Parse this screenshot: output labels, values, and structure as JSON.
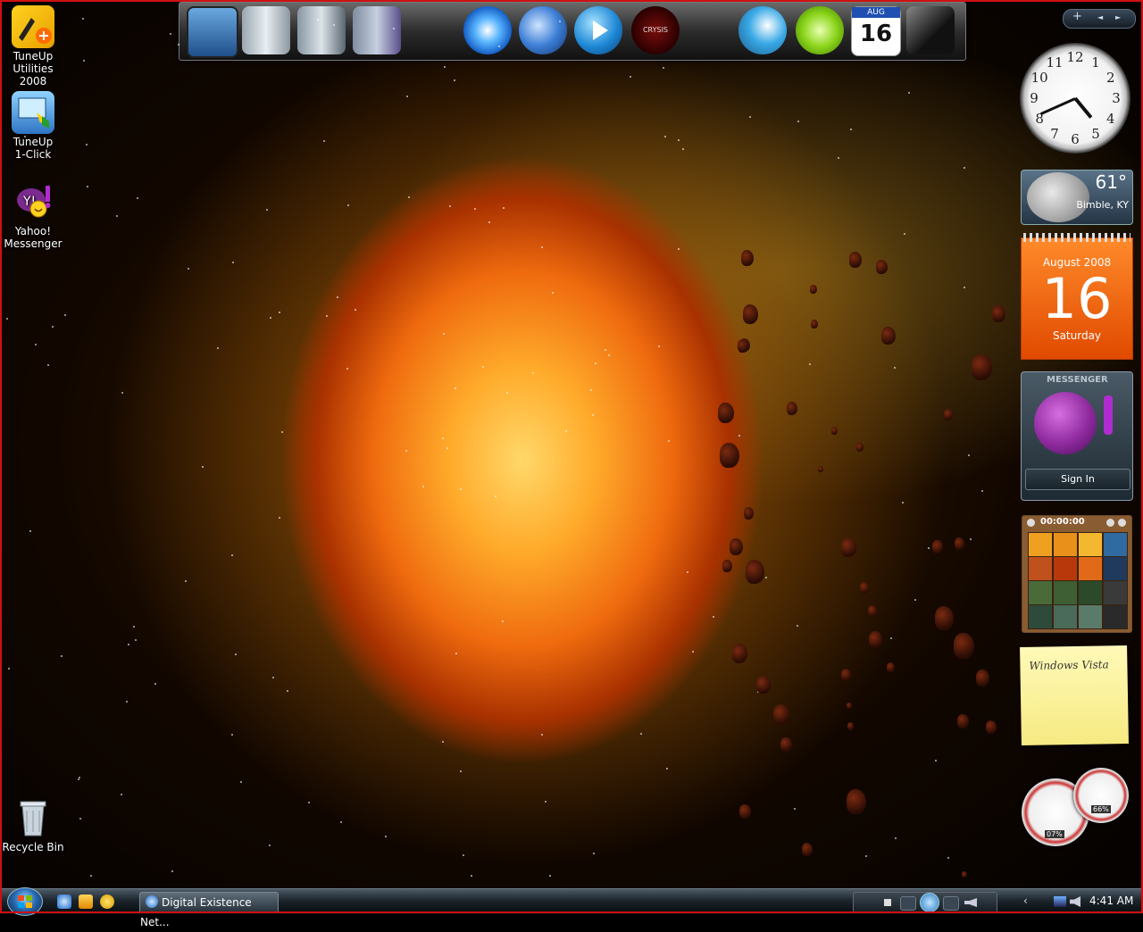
{
  "desktop_icons": [
    {
      "name": "TuneUp Utilities 2008",
      "line1": "TuneUp",
      "line2": "Utilities 2008"
    },
    {
      "name": "TuneUp 1-Click",
      "line1": "TuneUp",
      "line2": "1-Click"
    },
    {
      "name": "Yahoo! Messenger",
      "line1": "Yahoo!",
      "line2": "Messenger"
    },
    {
      "name": "Recycle Bin",
      "line1": "Recycle Bin",
      "line2": ""
    }
  ],
  "dock_icons": [
    "monitor-icon",
    "documents-icon",
    "pictures-icon",
    "music-icon",
    "internet-explorer-icon",
    "thunderbird-icon",
    "media-player-icon",
    "crysis-icon",
    "settings-icon",
    "limewire-icon",
    "calendar-icon",
    "steam-icon"
  ],
  "dock_calendar": {
    "month": "AUG",
    "day": "16"
  },
  "crysis_label": "CRYSIS",
  "clock": {
    "numbers": [
      "12",
      "1",
      "2",
      "3",
      "4",
      "5",
      "6",
      "7",
      "8",
      "9",
      "10",
      "11"
    ],
    "hour": 4,
    "minute": 41
  },
  "weather": {
    "temp": "61°",
    "location": "Bimble, KY"
  },
  "calendar": {
    "month_year": "August 2008",
    "day": "16",
    "weekday": "Saturday"
  },
  "yahoo_gadget": {
    "header": "MESSENGER",
    "sign_in": "Sign In"
  },
  "puzzle": {
    "timer": "00:00:00"
  },
  "note": {
    "text": "Windows Vista"
  },
  "meters": {
    "cpu": "07%",
    "memory": "66%"
  },
  "sidebar_controls": {
    "add": "+",
    "prev": "◄",
    "next": "►"
  },
  "taskbar": {
    "window_button": "Digital Existence Net...",
    "clock": "4:41 AM"
  }
}
